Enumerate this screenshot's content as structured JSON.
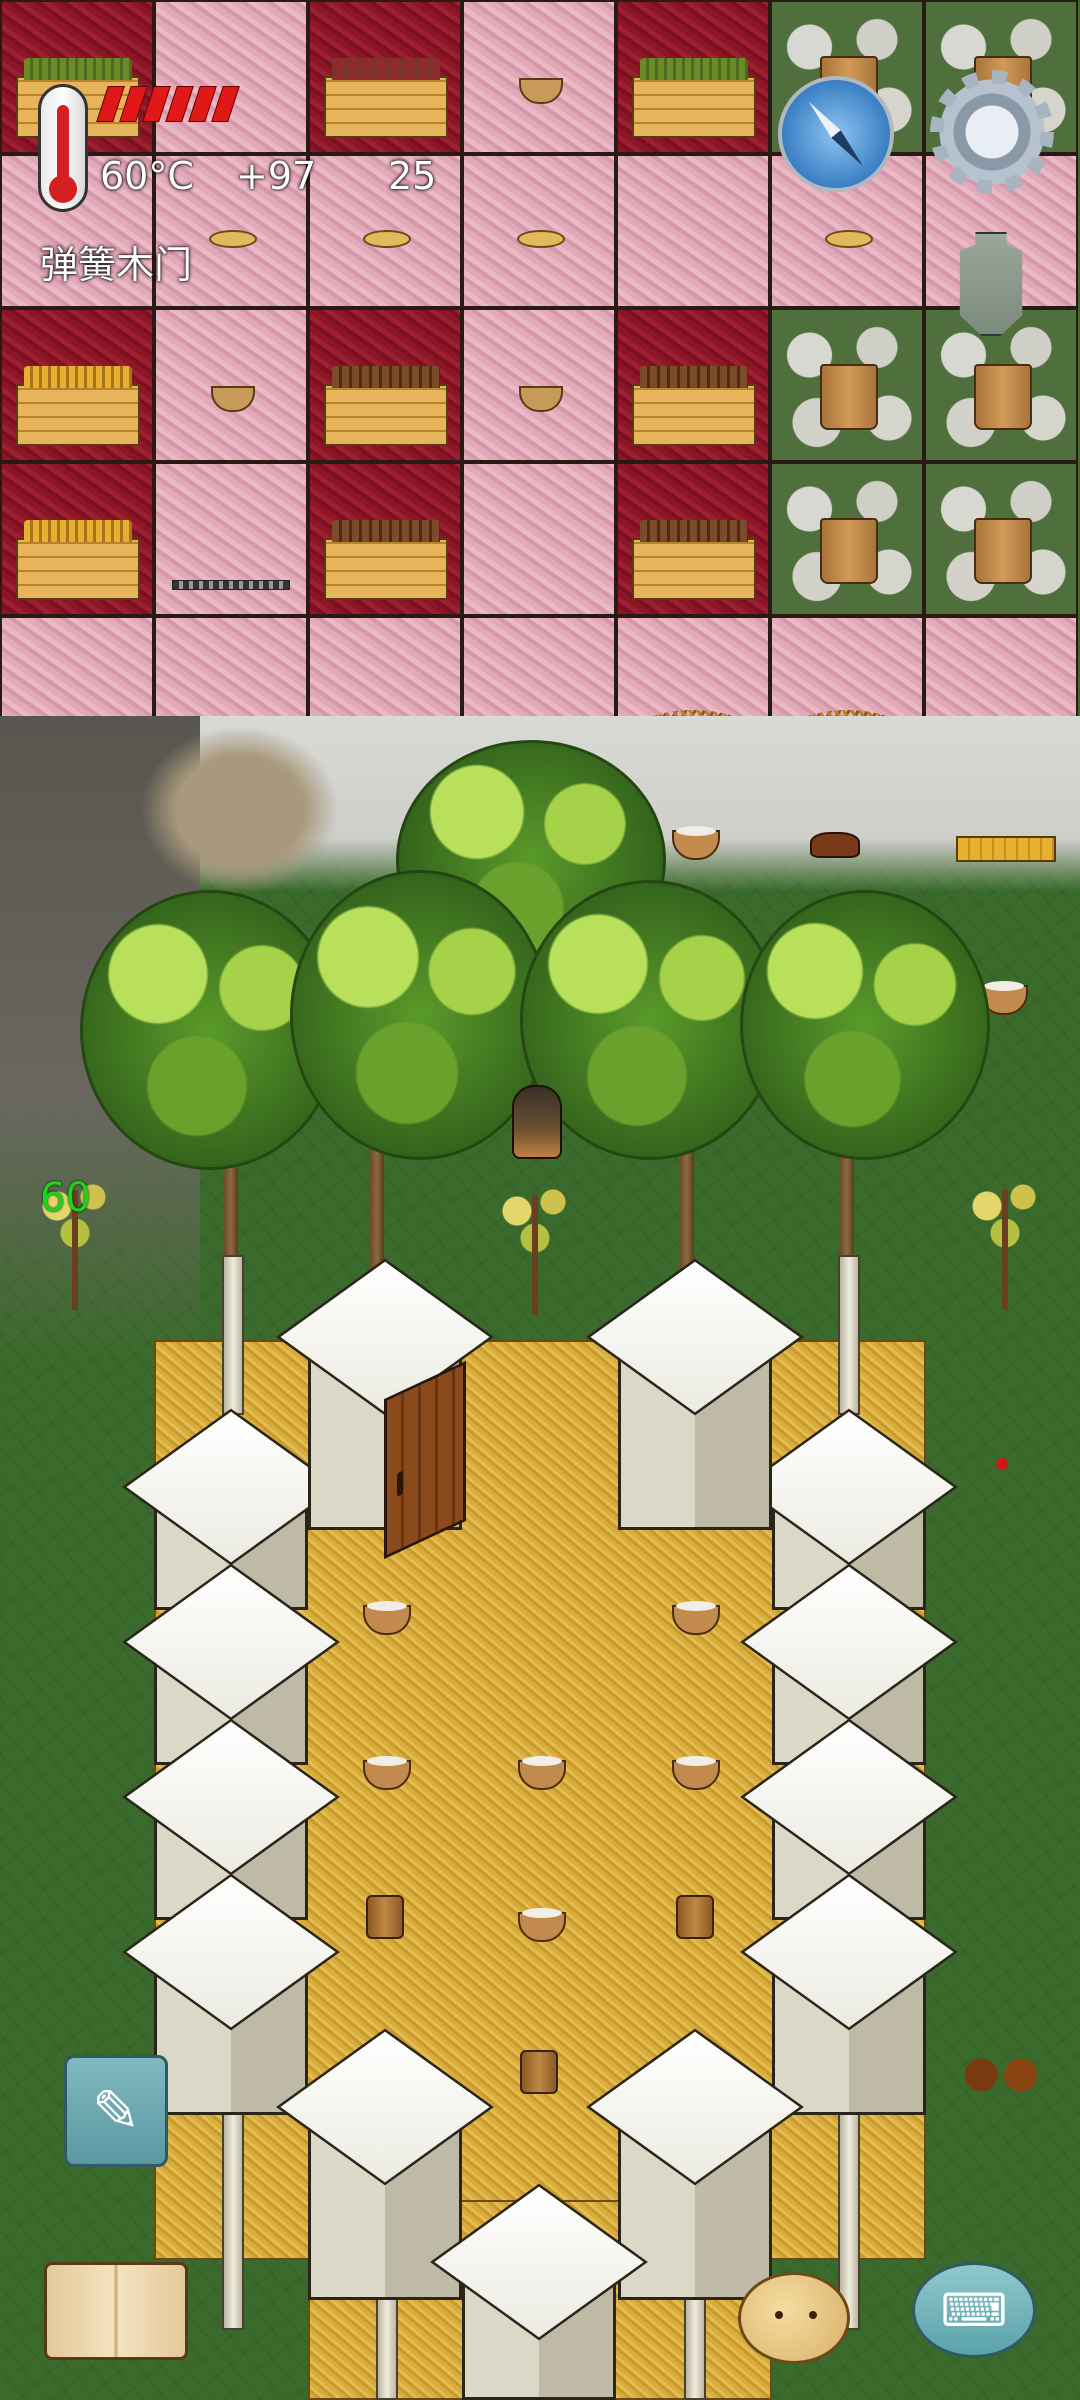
{
  "hud": {
    "temperature": "60°C",
    "food_bonus": "+97",
    "yum_count": "25",
    "held_object": "弹簧木门",
    "thermometer_icon": "thermometer-icon",
    "food_meter_icon": "food-meter-icon",
    "compass_icon": "compass-icon",
    "settings_icon": "gear-icon",
    "coin_icon": "coin-icon"
  },
  "player": {
    "age": "60"
  },
  "controls": {
    "edit_icon": "✎",
    "book_icon": "book-icon",
    "emote_icon": "potato-face-icon",
    "chat_icon": "⌨"
  }
}
